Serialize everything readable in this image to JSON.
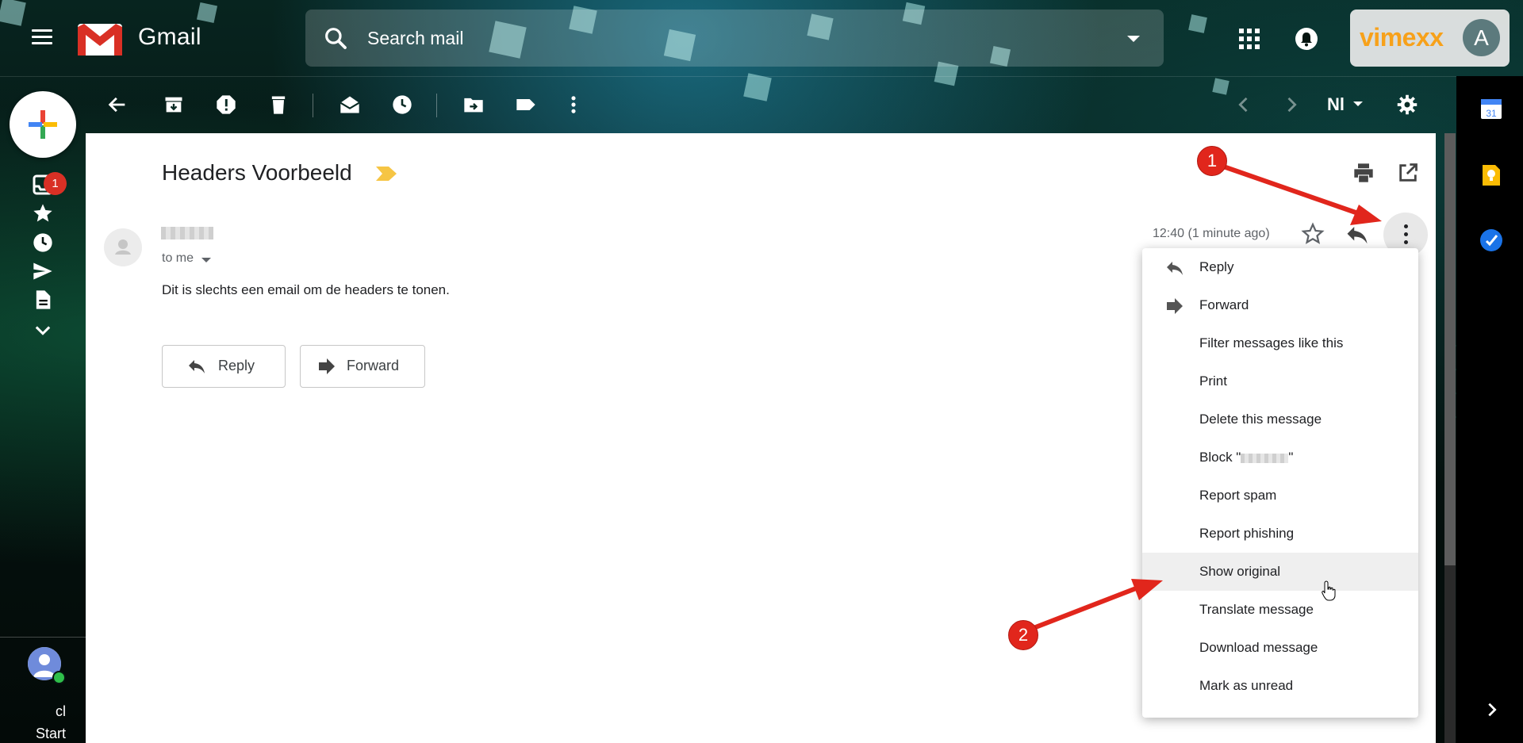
{
  "header": {
    "app_name": "Gmail",
    "search_placeholder": "Search mail",
    "brand": "vimexx",
    "account_initial": "A"
  },
  "rail": {
    "inbox_badge": "1",
    "user_text_1": "cl",
    "user_text_2": "Start"
  },
  "toolbar": {
    "language": "Nl"
  },
  "email": {
    "subject": "Headers Voorbeeld",
    "recipient": "to me",
    "body": "Dit is slechts een email om de headers te tonen.",
    "time": "12:40 (1 minute ago)",
    "reply_label": "Reply",
    "forward_label": "Forward"
  },
  "menu": {
    "items": [
      {
        "label": "Reply"
      },
      {
        "label": "Forward"
      },
      {
        "label": "Filter messages like this"
      },
      {
        "label": "Print"
      },
      {
        "label": "Delete this message"
      },
      {
        "label": "Block \""
      },
      {
        "label": "Report spam"
      },
      {
        "label": "Report phishing"
      },
      {
        "label": "Show original"
      },
      {
        "label": "Translate message"
      },
      {
        "label": "Download message"
      },
      {
        "label": "Mark as unread"
      }
    ]
  },
  "annotations": {
    "step_1": "1",
    "step_2": "2"
  },
  "colors": {
    "brand_orange": "#f7a11a",
    "badge_red": "#d93025",
    "annotation_red": "#e1261c",
    "label_yellow": "#f6c544"
  },
  "icons": [
    "menu-icon",
    "gmail-logo",
    "search-icon",
    "apps-icon",
    "bell-icon",
    "back-icon",
    "archive-icon",
    "spam-icon",
    "delete-icon",
    "mark-read-icon",
    "snooze-icon",
    "move-icon",
    "label-icon",
    "more-icon",
    "prev-icon",
    "next-icon",
    "settings-icon",
    "print-icon",
    "open-new-window-icon",
    "star-icon",
    "reply-icon",
    "forward-icon",
    "calendar-icon",
    "keep-icon",
    "tasks-icon",
    "chevron-right-icon"
  ]
}
